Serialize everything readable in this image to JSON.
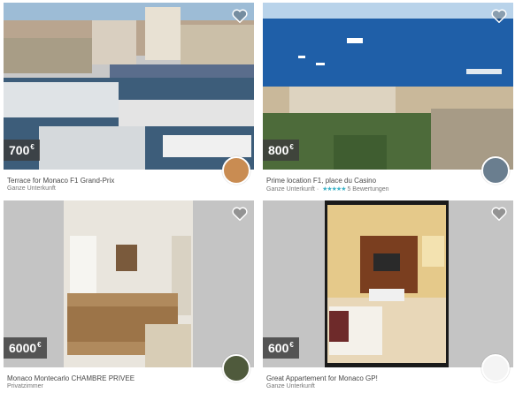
{
  "listings": [
    {
      "price": "700",
      "currency": "€",
      "title": "Terrace for Monaco F1 Grand-Prix",
      "room_type": "Ganze Unterkunft",
      "rating_stars": "",
      "reviews": ""
    },
    {
      "price": "800",
      "currency": "€",
      "title": "Prime location F1, place du Casino",
      "room_type": "Ganze Unterkunft",
      "rating_stars": "★★★★★",
      "reviews": "5 Bewertungen"
    },
    {
      "price": "6000",
      "currency": "€",
      "title": "Monaco Montecarlo CHAMBRE PRIVEE",
      "room_type": "Privatzimmer",
      "rating_stars": "",
      "reviews": ""
    },
    {
      "price": "600",
      "currency": "€",
      "title": "Great Appartement for Monaco GP!",
      "room_type": "Ganze Unterkunft",
      "rating_stars": "",
      "reviews": ""
    }
  ],
  "icons": {
    "favorite": "heart-icon"
  },
  "colors": {
    "star": "#3fb3c7",
    "price_bg": "#3c3c3c"
  }
}
